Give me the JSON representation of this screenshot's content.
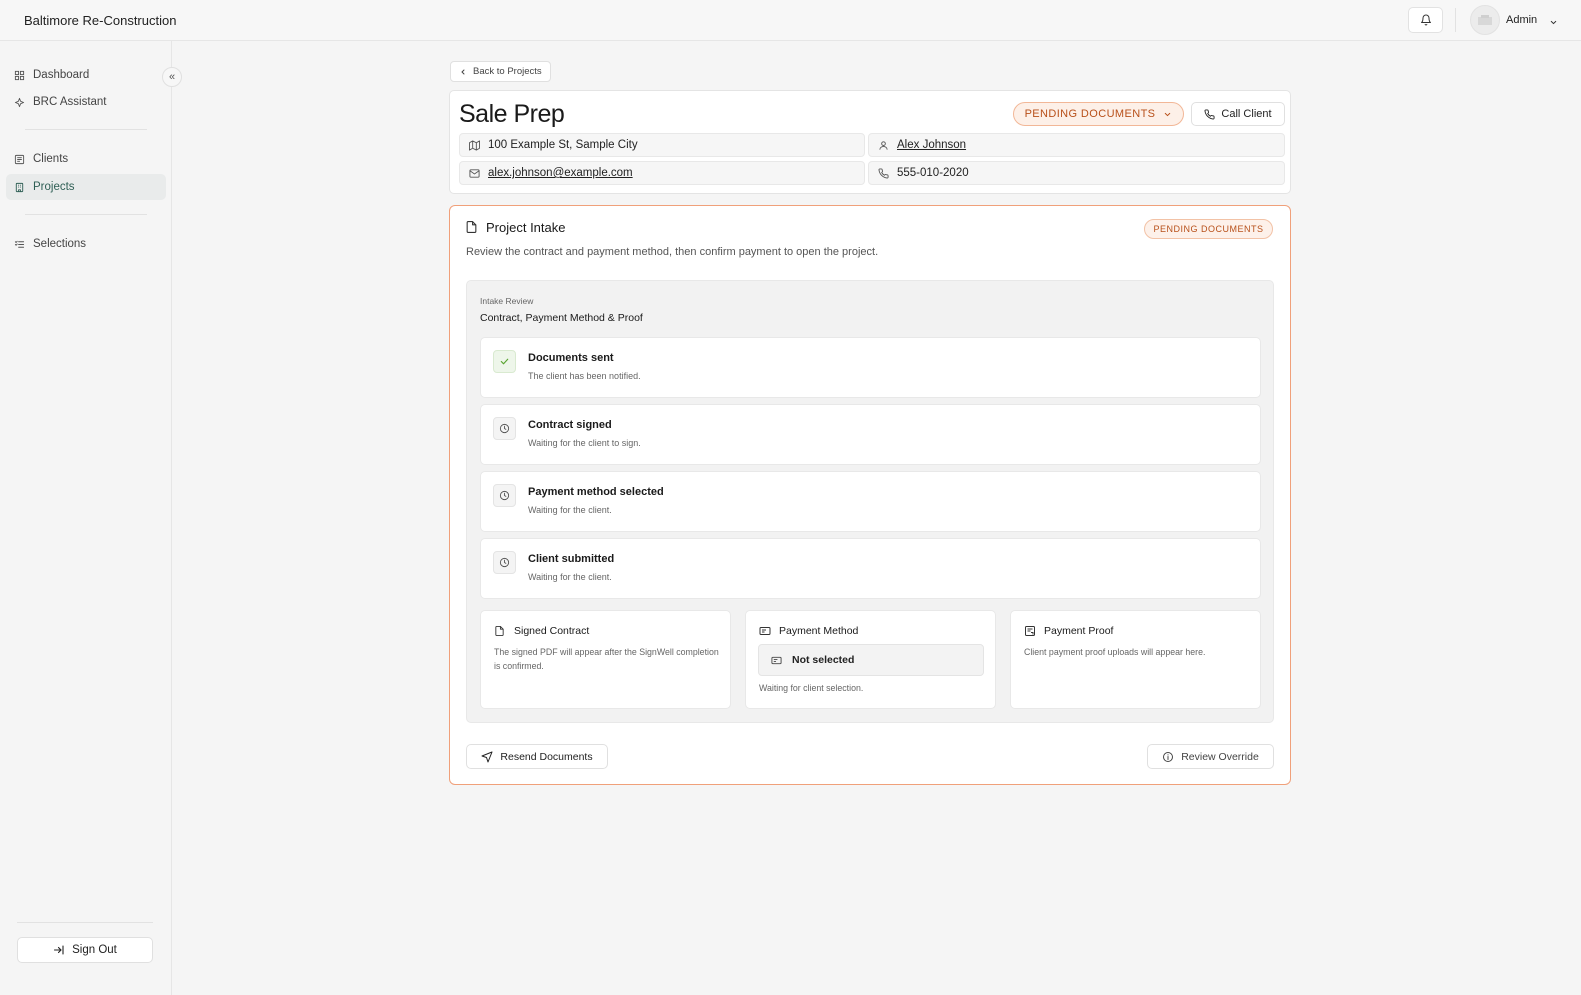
{
  "app": {
    "brand": "Baltimore Re-Construction"
  },
  "user": {
    "name": "Admin"
  },
  "sidebar": {
    "collapse_label": "«",
    "items": [
      {
        "label": "Dashboard",
        "icon": "grid-icon"
      },
      {
        "label": "BRC Assistant",
        "icon": "sparkle-icon"
      },
      {
        "label": "Clients",
        "icon": "contacts-icon"
      },
      {
        "label": "Projects",
        "icon": "building-icon",
        "active": true
      },
      {
        "label": "Selections",
        "icon": "list-check-icon"
      }
    ],
    "sign_out": "Sign Out"
  },
  "back": {
    "label": "Back to Projects"
  },
  "project": {
    "title": "Sale Prep",
    "status": "PENDING DOCUMENTS",
    "call_label": "Call Client",
    "address": "100 Example St, Sample City",
    "client_name": "Alex Johnson",
    "email": "alex.johnson@example.com",
    "phone": "555-010-2020"
  },
  "intake": {
    "title": "Project Intake",
    "badge": "PENDING DOCUMENTS",
    "description": "Review the contract and payment method, then confirm payment to open the project.",
    "review_label": "Intake Review",
    "review_title": "Contract, Payment Method & Proof",
    "steps": [
      {
        "title": "Documents sent",
        "subtitle": "The client has been notified.",
        "status": "done"
      },
      {
        "title": "Contract signed",
        "subtitle": "Waiting for the client to sign.",
        "status": "pending"
      },
      {
        "title": "Payment method selected",
        "subtitle": "Waiting for the client.",
        "status": "pending"
      },
      {
        "title": "Client submitted",
        "subtitle": "Waiting for the client.",
        "status": "pending"
      }
    ],
    "signed_contract": {
      "title": "Signed Contract",
      "text": "The signed PDF will appear after the SignWell completion is confirmed."
    },
    "payment_method": {
      "title": "Payment Method",
      "value": "Not selected",
      "note": "Waiting for client selection."
    },
    "payment_proof": {
      "title": "Payment Proof",
      "text": "Client payment proof uploads will appear here."
    },
    "resend_label": "Resend Documents",
    "override_label": "Review Override"
  },
  "colors": {
    "accent_orange": "#f0a07a",
    "status_text": "#b8501a",
    "active_nav": "#2f5f55",
    "done_check": "#5aa532"
  }
}
